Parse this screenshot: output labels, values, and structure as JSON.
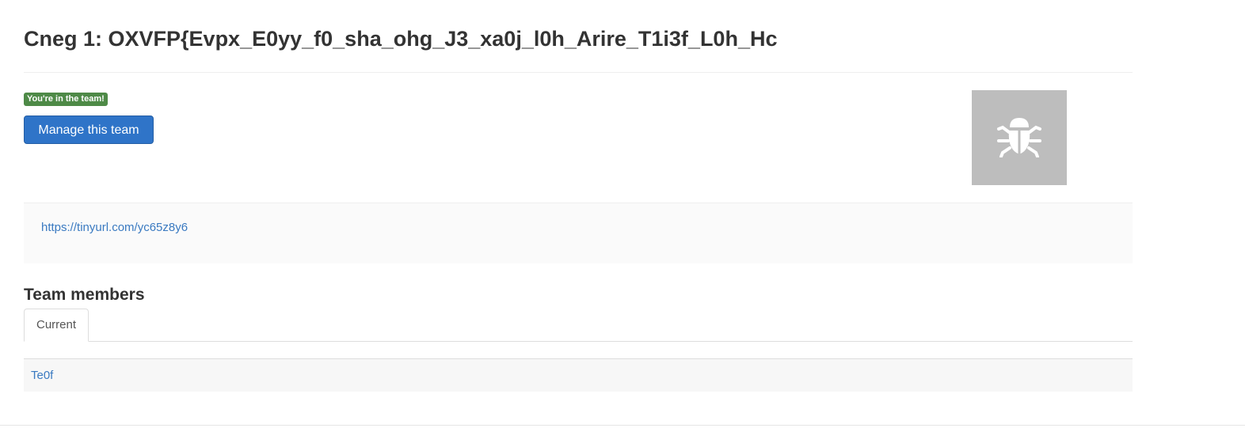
{
  "page": {
    "title": "Cneg 1: OXVFP{Evpx_E0yy_f0_sha_ohg_J3_xa0j_l0h_Arire_T1i3f_L0h_Hc"
  },
  "team": {
    "badge": "You're in the team!",
    "manage_button": "Manage this team",
    "avatar_icon": "bug-icon",
    "link": "https://tinyurl.com/yc65z8y6"
  },
  "members": {
    "heading": "Team members",
    "tabs": [
      {
        "label": "Current",
        "active": true
      }
    ],
    "rows": [
      {
        "name": "Te0f"
      }
    ]
  },
  "colors": {
    "badge": "#4e8a47",
    "primary": "#2f74c8",
    "link": "#3a7ac1",
    "avatar_bg": "#bdbdbd"
  }
}
